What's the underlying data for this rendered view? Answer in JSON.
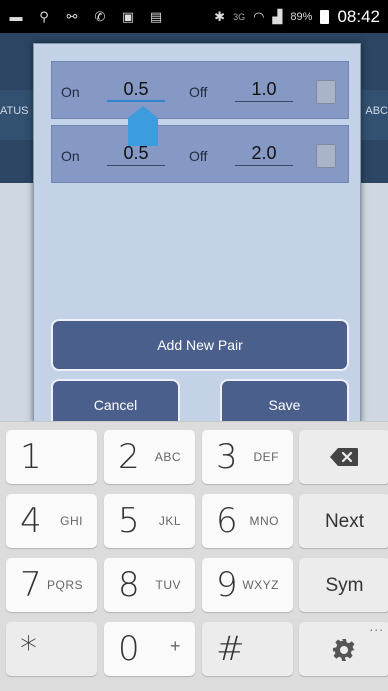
{
  "status_bar": {
    "battery_percent": "89%",
    "time": "08:42",
    "network": "3G",
    "left_icons": [
      "message-icon",
      "location-icon",
      "voicemail-icon",
      "wifi-calling-icon",
      "image-icon",
      "gallery-icon"
    ]
  },
  "background": {
    "left_edge_text": "ATUS",
    "right_edge_text": "ABC"
  },
  "dialog": {
    "pairs": [
      {
        "on_label": "On",
        "on_value": "0.5",
        "off_label": "Off",
        "off_value": "1.0",
        "checked": false
      },
      {
        "on_label": "On",
        "on_value": "0.5",
        "off_label": "Off",
        "off_value": "2.0",
        "checked": false
      }
    ],
    "add_button": "Add New Pair",
    "cancel_button": "Cancel",
    "save_button": "Save"
  },
  "keyboard": {
    "rows": [
      [
        {
          "main": "1",
          "sub": ""
        },
        {
          "main": "2",
          "sub": "ABC"
        },
        {
          "main": "3",
          "sub": "DEF"
        },
        {
          "main": "",
          "sub": "",
          "icon": "backspace-icon"
        }
      ],
      [
        {
          "main": "4",
          "sub": "GHI"
        },
        {
          "main": "5",
          "sub": "JKL"
        },
        {
          "main": "6",
          "sub": "MNO"
        },
        {
          "main": "Next",
          "sub": ""
        }
      ],
      [
        {
          "main": "7",
          "sub": "PQRS"
        },
        {
          "main": "8",
          "sub": "TUV"
        },
        {
          "main": "9",
          "sub": "WXYZ"
        },
        {
          "main": "Sym",
          "sub": ""
        }
      ],
      [
        {
          "main": "*",
          "sub": ""
        },
        {
          "main": "0",
          "sub": "+"
        },
        {
          "main": "#",
          "sub": ""
        },
        {
          "main": "",
          "sub": "",
          "icon": "settings-icon"
        }
      ]
    ],
    "settings_more": "..."
  },
  "colors": {
    "dialog_bg": "#c3d2e6",
    "row_bg": "#8698c4",
    "button_bg": "#4a5f8c",
    "cursor": "#3d9cde"
  }
}
